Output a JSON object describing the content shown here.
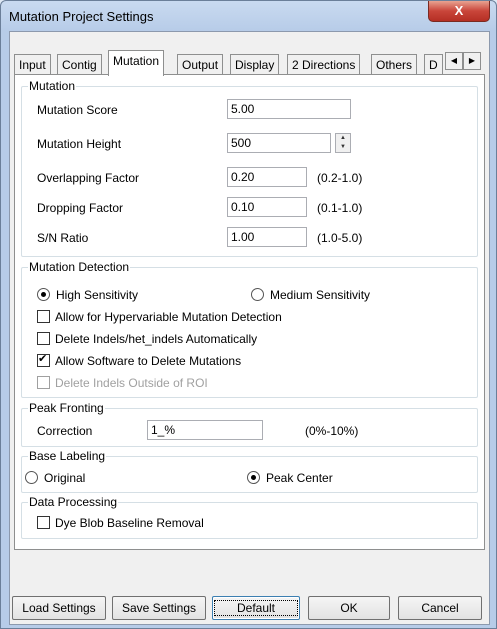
{
  "window": {
    "title": "Mutation Project Settings",
    "close_label": "X"
  },
  "tabs": [
    {
      "label": "Input"
    },
    {
      "label": "Contig"
    },
    {
      "label": "Mutation"
    },
    {
      "label": "Output"
    },
    {
      "label": "Display"
    },
    {
      "label": "2 Directions"
    },
    {
      "label": "Others"
    },
    {
      "label": "D"
    }
  ],
  "tab_scroll": {
    "left_glyph": "◀",
    "right_glyph": "▶"
  },
  "mutation": {
    "legend": "Mutation",
    "fields": [
      {
        "label": "Mutation Score",
        "value": "5.00",
        "range": ""
      },
      {
        "label": "Mutation Height",
        "value": "500",
        "range": ""
      },
      {
        "label": "Overlapping Factor",
        "value": "0.20",
        "range": "(0.2-1.0)"
      },
      {
        "label": "Dropping Factor",
        "value": "0.10",
        "range": "(0.1-1.0)"
      },
      {
        "label": "S/N Ratio",
        "value": "1.00",
        "range": "(1.0-5.0)"
      }
    ],
    "spinner": {
      "up": "▲",
      "down": "▼"
    }
  },
  "detection": {
    "legend": "Mutation Detection",
    "radios": [
      {
        "label": "High Sensitivity",
        "checked": true
      },
      {
        "label": "Medium Sensitivity",
        "checked": false
      }
    ],
    "checkboxes": [
      {
        "label": "Allow for Hypervariable Mutation Detection",
        "checked": false,
        "enabled": true
      },
      {
        "label": "Delete Indels/het_indels Automatically",
        "checked": false,
        "enabled": true
      },
      {
        "label": "Allow Software to Delete Mutations",
        "checked": true,
        "enabled": true
      },
      {
        "label": "Delete Indels Outside of ROI",
        "checked": false,
        "enabled": false
      }
    ]
  },
  "peak_fronting": {
    "legend": "Peak Fronting",
    "label": "Correction",
    "value": "1_%",
    "range": "(0%-10%)"
  },
  "base_labeling": {
    "legend": "Base Labeling",
    "radios": [
      {
        "label": "Original",
        "checked": false
      },
      {
        "label": "Peak Center",
        "checked": true
      }
    ]
  },
  "data_processing": {
    "legend": "Data Processing",
    "checkbox": {
      "label": "Dye Blob Baseline Removal",
      "checked": false
    }
  },
  "buttons": {
    "load": "Load Settings",
    "save": "Save Settings",
    "default": "Default",
    "ok": "OK",
    "cancel": "Cancel"
  }
}
